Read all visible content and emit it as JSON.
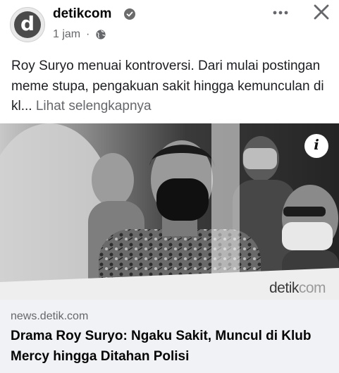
{
  "header": {
    "page_name": "detikcom",
    "avatar_letter": "d",
    "time": "1 jam",
    "separator": "·",
    "privacy_icon": "globe-icon",
    "verified_icon": "verified-check-icon",
    "more_icon": "more-horizontal-icon",
    "close_icon": "close-icon",
    "close_label": "✕"
  },
  "post": {
    "text": "Roy Suryo menuai kontroversi. Dari mulai postingan meme stupa, pengakuan sakit hingga kemunculan di kl...",
    "see_more": "Lihat selengkapnya"
  },
  "link_preview": {
    "info_label": "i",
    "watermark_primary": "detik",
    "watermark_secondary": "com",
    "domain": "news.detik.com",
    "title": "Drama Roy Suryo: Ngaku Sakit, Muncul di Klub Mercy hingga Ditahan Polisi"
  },
  "colors": {
    "text_primary": "#050505",
    "text_secondary": "#65676b",
    "caption_bg": "#f0f2f5"
  }
}
